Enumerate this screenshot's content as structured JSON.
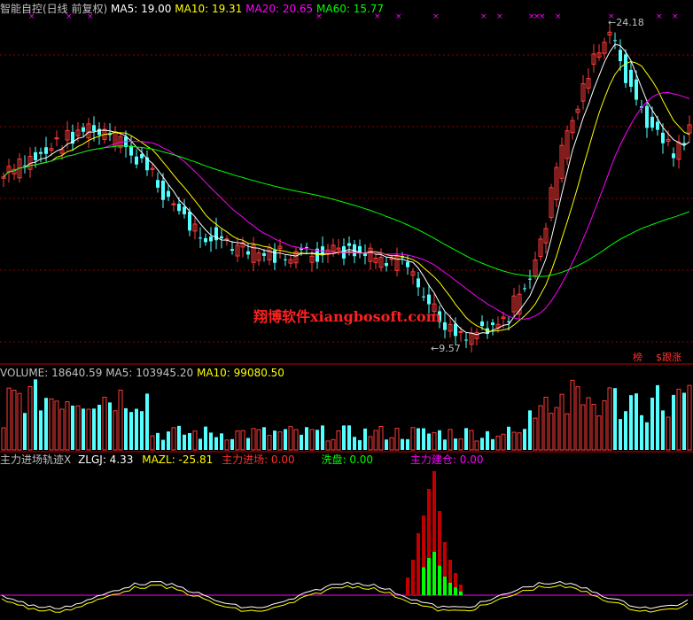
{
  "price_header": {
    "title": "智能自控(日线 前复权)",
    "ma5_label": "MA5: 19.00",
    "ma10_label": "MA10: 19.31",
    "ma20_label": "MA20: 20.65",
    "ma60_label": "MA60: 15.77"
  },
  "volume_header": {
    "volume_label": "VOLUME: 18640.59",
    "ma5_label": "MA5: 103945.20",
    "ma10_label": "MA10: 99080.50"
  },
  "indicator_header": {
    "name": "主力进场轨迹",
    "close_mark": "X",
    "zlgj_label": "ZLGJ: 4.33",
    "mazl_label": "MAZL: -25.81",
    "enter_label": "主力进场: 0.00",
    "wash_label": "洗盘: 0.00",
    "build_label": "主力建仓: 0.00"
  },
  "annotations": {
    "high_price": "24.18",
    "low_price": "9.57",
    "watermark": "翔博软件xiangbosoft.com"
  },
  "buttons": {
    "rank": "榜",
    "follow": "$跟涨"
  },
  "colors": {
    "up": "#ff3b3b",
    "down": "#54ffff",
    "ma5": "#ffffff",
    "ma10": "#ffff00",
    "ma20": "#ff00ff",
    "ma60": "#00ff00",
    "grid": "#8b0000"
  },
  "chart_data": {
    "type": "candlestick",
    "high": 24.18,
    "low": 9.57,
    "ma_periods": [
      5,
      10,
      20,
      60
    ]
  }
}
